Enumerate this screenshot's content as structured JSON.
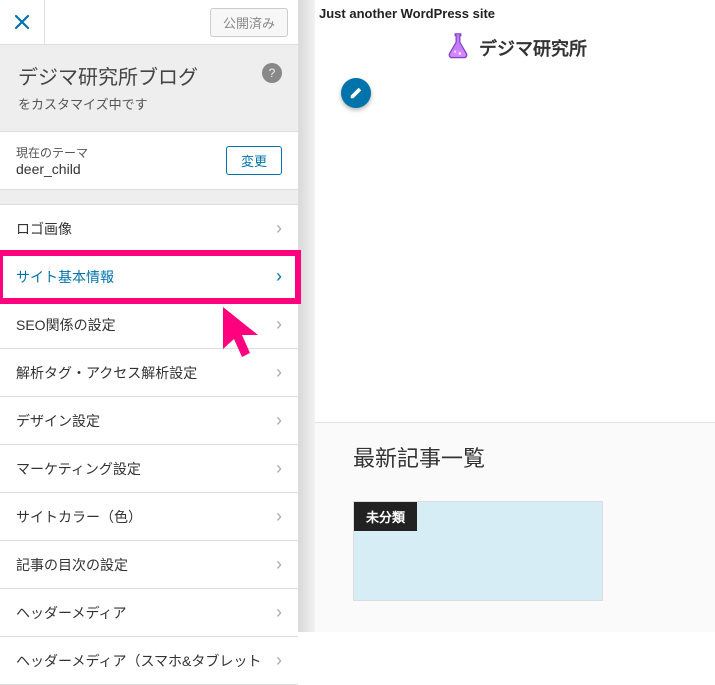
{
  "topbar": {
    "publish_label": "公開済み"
  },
  "title": {
    "site_title": "デジマ研究所ブログ",
    "subtitle": "をカスタマイズ中です",
    "help_glyph": "?"
  },
  "theme": {
    "label": "現在のテーマ",
    "name": "deer_child",
    "change_label": "変更"
  },
  "sections": [
    {
      "label": "ロゴ画像",
      "highlight": false
    },
    {
      "label": "サイト基本情報",
      "highlight": true
    },
    {
      "label": "SEO関係の設定",
      "highlight": false
    },
    {
      "label": "解析タグ・アクセス解析設定",
      "highlight": false
    },
    {
      "label": "デザイン設定",
      "highlight": false
    },
    {
      "label": "マーケティング設定",
      "highlight": false
    },
    {
      "label": "サイトカラー（色）",
      "highlight": false
    },
    {
      "label": "記事の目次の設定",
      "highlight": false
    },
    {
      "label": "ヘッダーメディア",
      "highlight": false
    },
    {
      "label": "ヘッダーメディア（スマホ&タブレット",
      "highlight": false
    }
  ],
  "preview": {
    "tagline": "Just another WordPress site",
    "logo_text": "デジマ研究所",
    "posts_heading": "最新記事一覧",
    "post_category": "未分類"
  },
  "colors": {
    "accent": "#0073aa",
    "highlight_box": "#ff007f"
  }
}
